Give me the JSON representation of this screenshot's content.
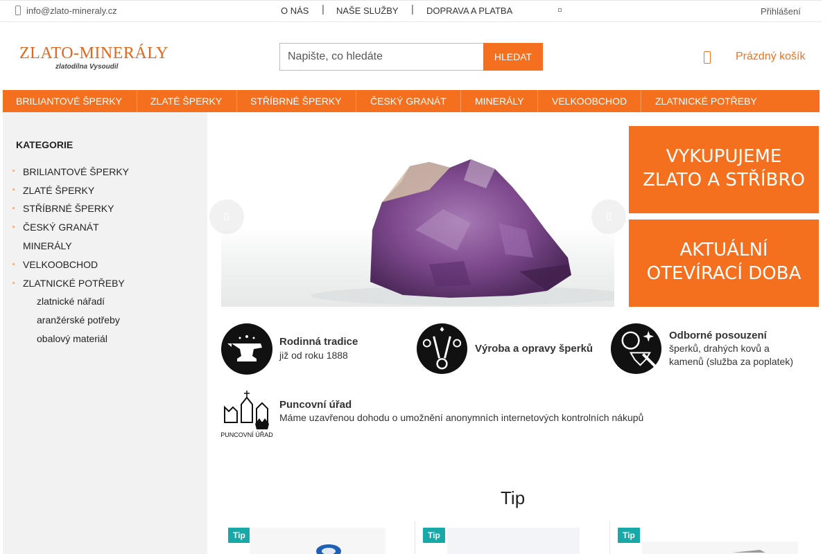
{
  "topbar": {
    "email": "info@zlato-mineraly.cz",
    "nav": [
      "O NÁS",
      "NAŠE SLUŽBY",
      "DOPRAVA A PLATBA"
    ],
    "separator": "|",
    "login": "Přihlášení"
  },
  "logo": {
    "main": "ZLATO-MINERÁLY",
    "sub": "zlatodílna Vysoudil"
  },
  "search": {
    "placeholder": "Napište, co hledáte",
    "button": "HLEDAT"
  },
  "cart": {
    "label": "Prázdný košík"
  },
  "main_menu": [
    "BRILIANTOVÉ ŠPERKY",
    "ZLATÉ ŠPERKY",
    "STŘÍBRNÉ ŠPERKY",
    "ČESKÝ GRANÁT",
    "MINERÁLY",
    "VELKOOBCHOD",
    "ZLATNICKÉ POTŘEBY"
  ],
  "sidebar": {
    "title": "KATEGORIE",
    "categories": [
      "BRILIANTOVÉ ŠPERKY",
      "ZLATÉ ŠPERKY",
      "STŘÍBRNÉ ŠPERKY",
      "ČESKÝ GRANÁT",
      "MINERÁLY",
      "VELKOOBCHOD",
      "ZLATNICKÉ POTŘEBY"
    ],
    "subcategories": [
      "zlatnické nářadí",
      "aranžérské potřeby",
      "obalový materiál"
    ]
  },
  "banners": {
    "buy": [
      "VYKUPUJEME",
      "ZLATO A STŘÍBRO"
    ],
    "hours": [
      "AKTUÁLNÍ",
      "OTEVÍRACÍ DOBA"
    ]
  },
  "features": {
    "tradition": {
      "title": "Rodinná tradice",
      "text": "již od roku 1888"
    },
    "production": {
      "title": "Výroba a opravy šperků"
    },
    "assessment": {
      "title": "Odborné posouzení",
      "text1": "šperků, drahých kovů a",
      "text2": "kamenů (služba za poplatek)"
    },
    "assay": {
      "title": "Puncovní úřad",
      "text": "Máme uzavřenou dohodu o umožnění anonymních internetových kontrolních nákupů",
      "logo_text": "PUNCOVNÍ ÚŘAD"
    }
  },
  "tip": {
    "heading": "Tip",
    "badge": "Tip"
  },
  "colors": {
    "accent": "#f4701e",
    "badge": "#16a9a7",
    "sidebar_bg": "#f2f2f2"
  },
  "icons": [
    "email-icon",
    "cart-icon",
    "slider-prev-icon",
    "slider-next-icon",
    "anvil-icon",
    "pliers-rings-icon",
    "magnifier-diamond-icon",
    "assay-office-logo"
  ]
}
